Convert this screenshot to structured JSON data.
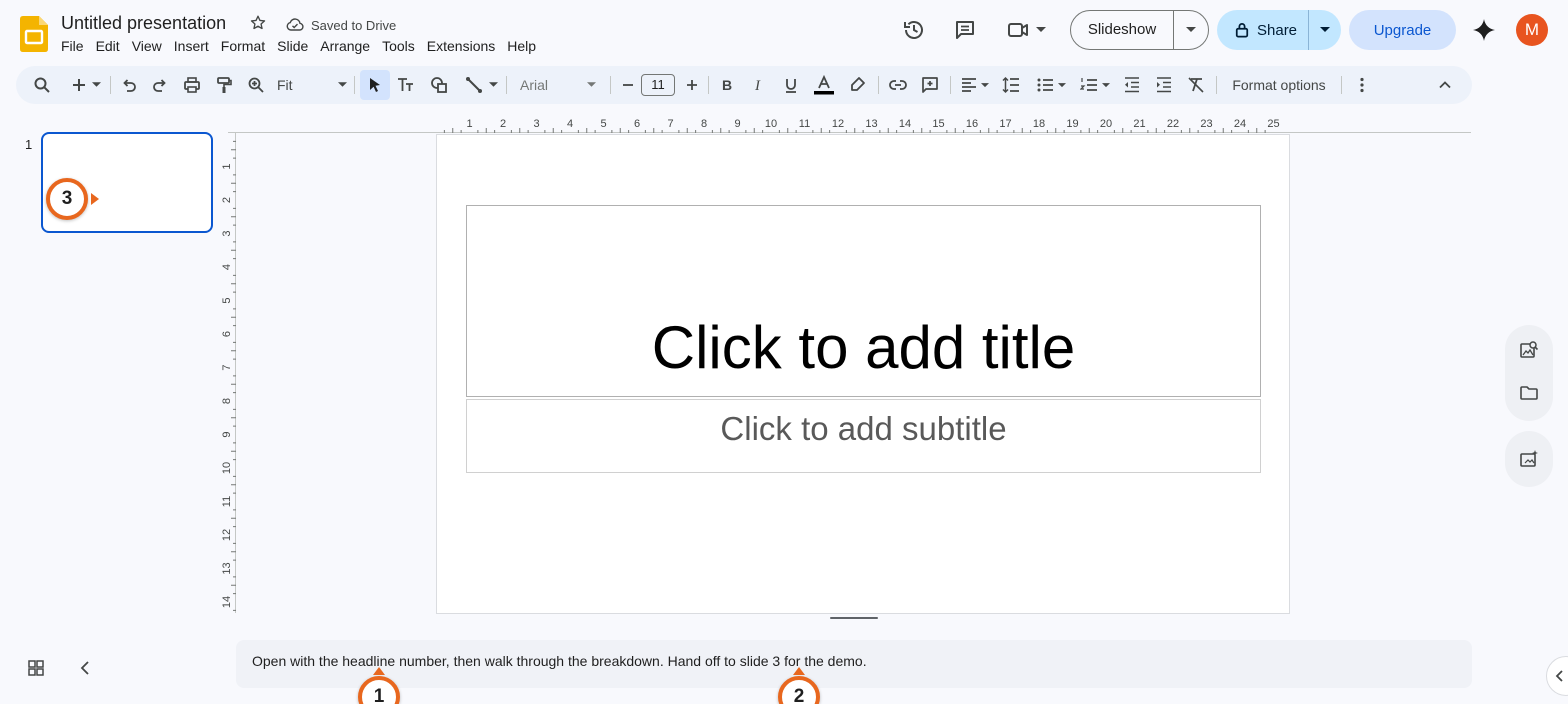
{
  "app": {
    "name": "Google Slides"
  },
  "doc": {
    "title": "Untitled presentation",
    "save_status": "Saved to Drive"
  },
  "menu": [
    "File",
    "Edit",
    "View",
    "Insert",
    "Format",
    "Slide",
    "Arrange",
    "Tools",
    "Extensions",
    "Help"
  ],
  "header": {
    "slideshow_label": "Slideshow",
    "share_label": "Share",
    "upgrade_label": "Upgrade",
    "avatar_letter": "M",
    "avatar_color": "#e8541f"
  },
  "toolbar": {
    "zoom": "Fit",
    "font": "Arial",
    "font_size": "11",
    "format_options": "Format options"
  },
  "slides": {
    "current_number": "1"
  },
  "ruler": {
    "horizontal": [
      "1",
      "2",
      "3",
      "4",
      "5",
      "6",
      "7",
      "8",
      "9",
      "10",
      "11",
      "12",
      "13",
      "14",
      "15",
      "16",
      "17",
      "18",
      "19",
      "20",
      "21",
      "22",
      "23",
      "24",
      "25"
    ],
    "vertical": [
      "1",
      "2",
      "3",
      "4",
      "5",
      "6",
      "7",
      "8",
      "9",
      "10",
      "11",
      "12",
      "13",
      "14"
    ]
  },
  "slide": {
    "title_placeholder": "Click to add title",
    "subtitle_placeholder": "Click to add subtitle"
  },
  "notes": {
    "text": "Open with the headline number, then walk through the breakdown. Hand off to slide 3 for the demo."
  },
  "annotations": [
    "1",
    "2",
    "3"
  ],
  "colors": {
    "accent": "#0b57d0",
    "badge": "#e8671e",
    "share_bg": "#c2e7ff",
    "upgrade_bg": "#d3e3fd"
  }
}
